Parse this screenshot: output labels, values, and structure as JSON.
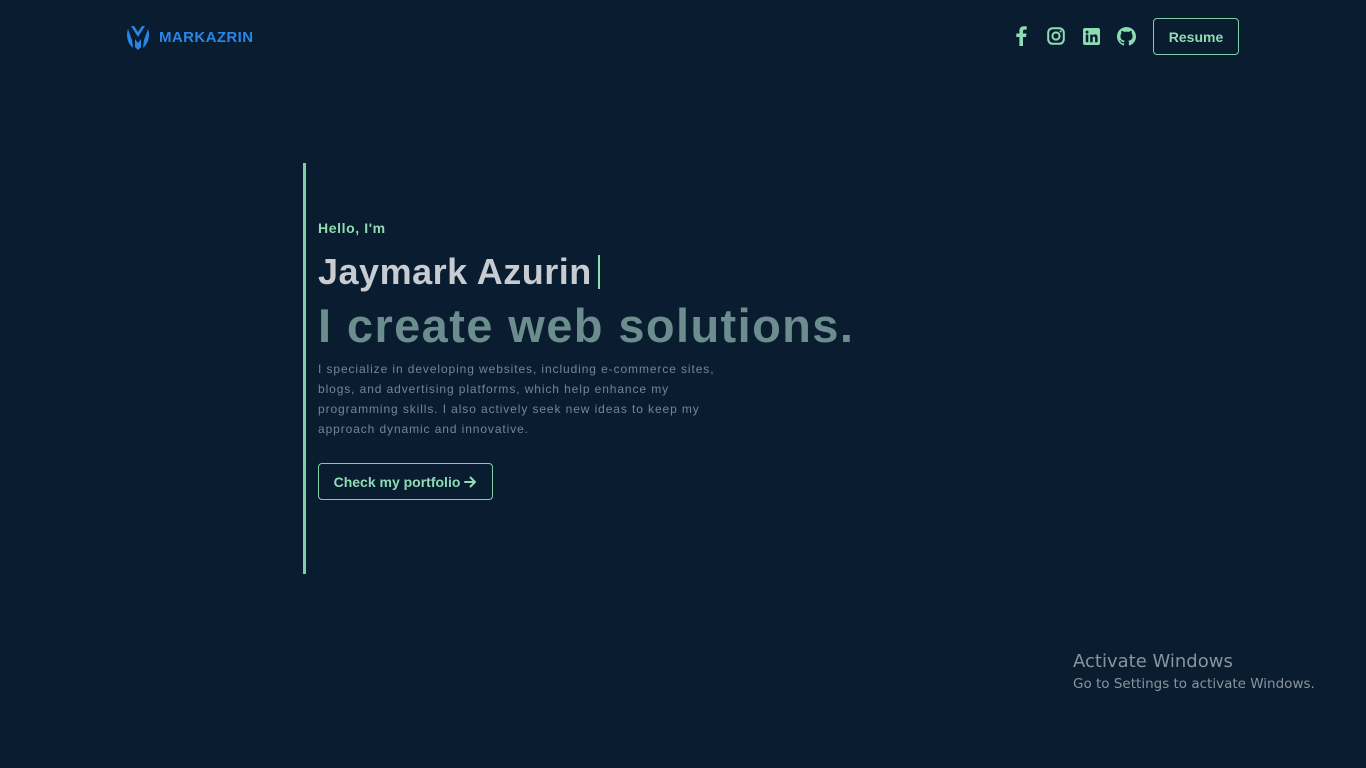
{
  "nav": {
    "logo_text": "MARKAZRIN",
    "social_icons": [
      "facebook-icon",
      "instagram-icon",
      "linkedin-icon",
      "github-icon"
    ],
    "resume_label": "Resume"
  },
  "hero": {
    "greeting": "Hello, I'm",
    "name": "Jaymark Azurin",
    "tagline": "I create web solutions.",
    "bio": "I specialize in developing websites, including e-commerce sites, blogs, and advertising platforms, which help enhance my programming skills. I also actively seek new ideas to keep my approach dynamic and innovative.",
    "cta_label": "Check my portfolio"
  },
  "watermark": {
    "title": "Activate Windows",
    "subtitle": "Go to Settings to activate Windows."
  },
  "colors": {
    "background": "#091c30",
    "accent": "#8fdcb3",
    "logo": "#2a86e6",
    "name": "#c8cbd0",
    "tagline": "#6b8d8d",
    "body_text": "#6f8896"
  }
}
